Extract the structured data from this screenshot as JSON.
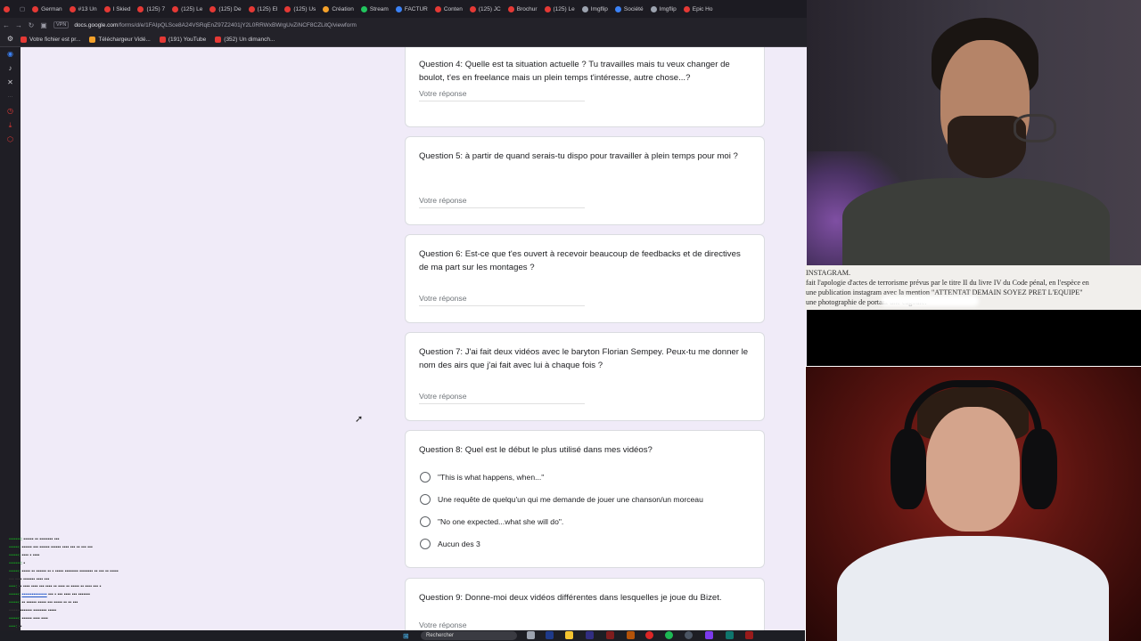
{
  "browser": {
    "tabs": [
      {
        "label": "German",
        "color": "#e53935"
      },
      {
        "label": "#13 Un",
        "color": "#e53935"
      },
      {
        "label": "I Skied",
        "color": "#e53935"
      },
      {
        "label": "(125) 7",
        "color": "#e53935"
      },
      {
        "label": "(125) Le",
        "color": "#e53935"
      },
      {
        "label": "(125) De",
        "color": "#e53935"
      },
      {
        "label": "(125) El",
        "color": "#e53935"
      },
      {
        "label": "(125) Us",
        "color": "#e53935"
      },
      {
        "label": "Création",
        "color": "#f4a12a"
      },
      {
        "label": "Stream",
        "color": "#22c55e"
      },
      {
        "label": "FACTUR",
        "color": "#3b82f6"
      },
      {
        "label": "Conten",
        "color": "#e53935"
      },
      {
        "label": "(125) JC",
        "color": "#e53935"
      },
      {
        "label": "Brochur",
        "color": "#e53935"
      },
      {
        "label": "(125) Le",
        "color": "#e53935"
      },
      {
        "label": "Imgflip",
        "color": "#9ca3af"
      },
      {
        "label": "Société",
        "color": "#3b82f6"
      },
      {
        "label": "Imgflip",
        "color": "#9ca3af"
      },
      {
        "label": "Epic Ho",
        "color": "#e53935"
      }
    ],
    "vpn": "VPN",
    "url_host": "docs.google.com",
    "url_path": "/forms/d/e/1FAIpQLSce8A24VSRqEnZ97Z2401jY2L0RRWxBWrgUvZiNCF8CZLitQ/viewform",
    "bookmarks": [
      {
        "label": "Votre fichier est pr...",
        "color": "#e53935"
      },
      {
        "label": "Téléchargeur Vidé...",
        "color": "#f4a12a"
      },
      {
        "label": "(191) YouTube",
        "color": "#e53935"
      },
      {
        "label": "(352) Un dimanch...",
        "color": "#e53935"
      }
    ]
  },
  "form": {
    "answer_placeholder": "Votre réponse",
    "questions": [
      {
        "text": "Question 4: Quelle est ta situation actuelle ? Tu travailles mais tu veux changer de boulot, t'es en freelance mais un plein temps t'intéresse, autre chose...?"
      },
      {
        "text": "Question 5: à partir de quand serais-tu dispo pour travailler à plein temps pour moi ?"
      },
      {
        "text": "Question 6: Est-ce que t'es ouvert à recevoir beaucoup de feedbacks et de directives de ma part sur les montages ?"
      },
      {
        "text": "Question 7: J'ai fait deux vidéos avec le baryton Florian Sempey. Peux-tu me donner le nom des airs que j'ai fait avec lui à chaque fois ?"
      },
      {
        "text": "Question 8: Quel est le début le plus utilisé dans mes vidéos?",
        "options": [
          "\"This is what happens, when...\"",
          "Une requête de quelqu'un qui me demande de jouer une chanson/un morceau",
          "\"No one expected...what she will do\".",
          "Aucun des 3"
        ]
      },
      {
        "text": "Question 9: Donne-moi deux vidéos différentes dans lesquelles je joue du Bizet."
      }
    ]
  },
  "taskbar": {
    "search": "Rechercher"
  },
  "overlay_document": {
    "lines": [
      "INSTAGRAM.",
      "fait l'apologie d'actes de terrorisme prévus par le titre II du livre IV du Code pénal, en l'espèce en",
      "une publication instagram avec la mention \"ATTENTAT DEMAIN SOYEZ PRET L'EQUIPE\"",
      "une photographie de                                  portant une cagoule."
    ]
  }
}
